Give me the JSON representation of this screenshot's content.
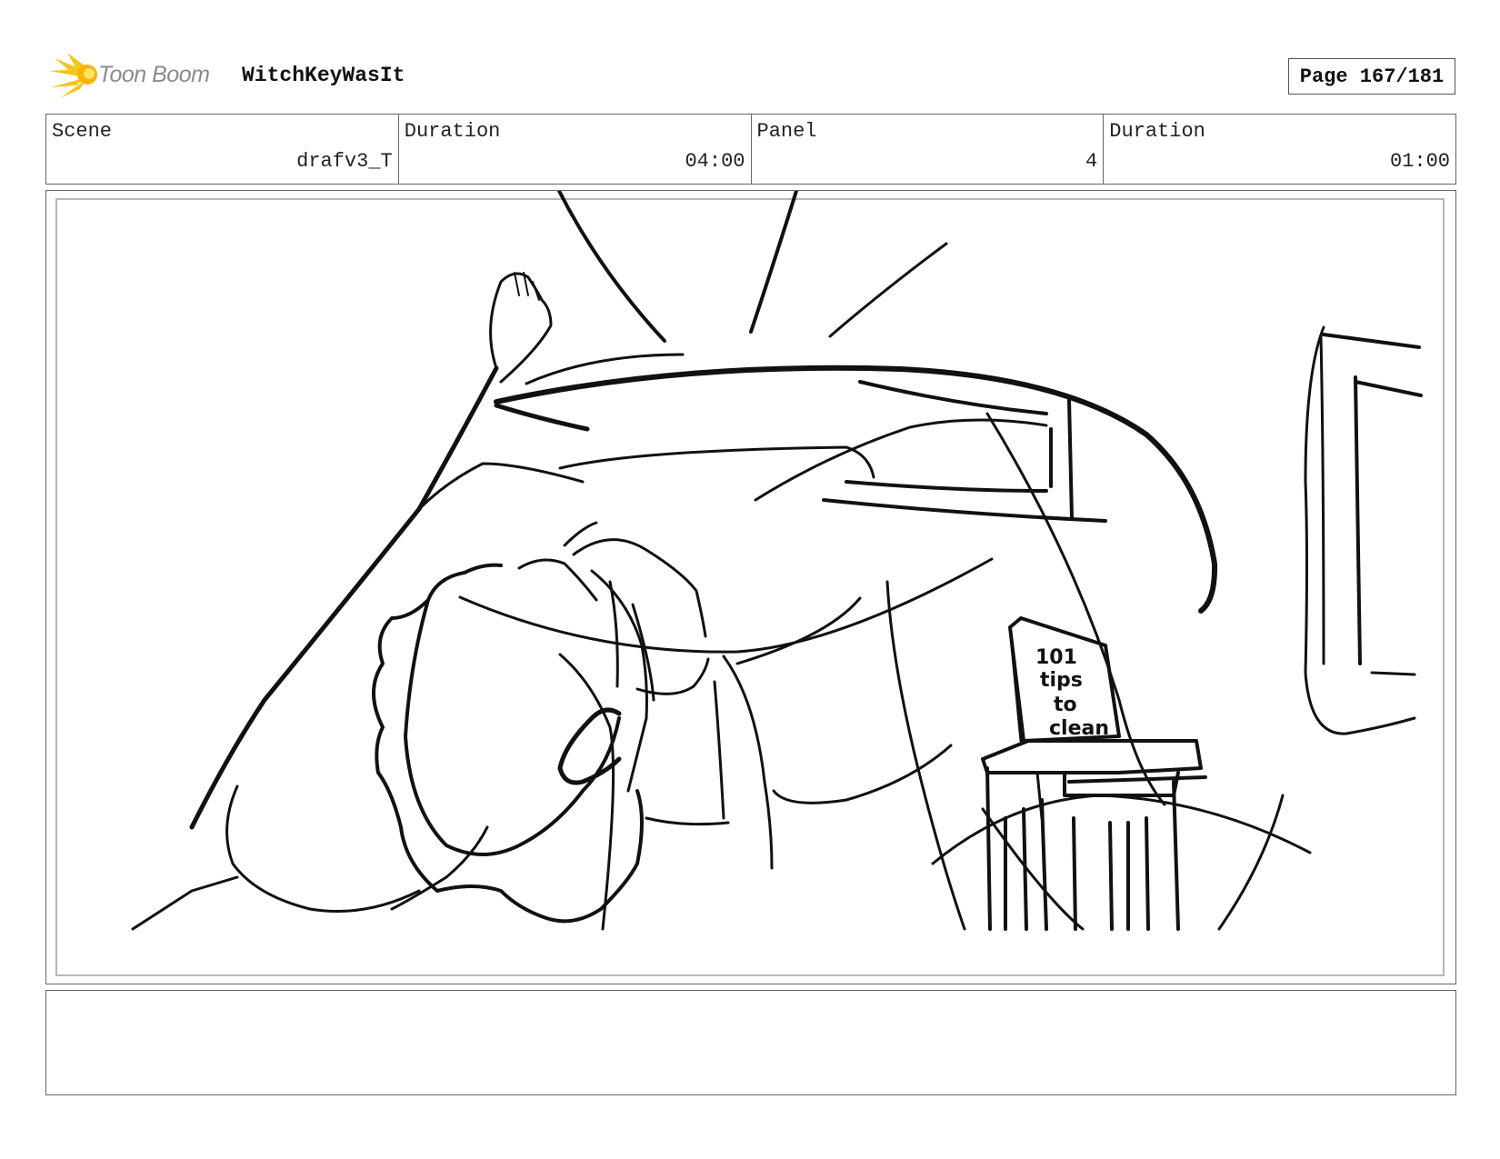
{
  "header": {
    "brand": "Toon Boom",
    "brand_icon": "toon-boom-starburst-icon",
    "project_title": "WitchKeyWasIt",
    "page_label": "Page 167/181"
  },
  "info": {
    "scene_label": "Scene",
    "scene_value": "drafv3_T",
    "scene_duration_label": "Duration",
    "scene_duration_value": "04:00",
    "panel_label": "Panel",
    "panel_value": "4",
    "panel_duration_label": "Duration",
    "panel_duration_value": "01:00"
  },
  "panel": {
    "sketch_text": [
      "101",
      "tips",
      "to",
      "clean"
    ]
  },
  "notes": {
    "text": ""
  },
  "colors": {
    "logo_yellow": "#f5c518",
    "logo_orange": "#f39c12",
    "ink": "#111111"
  }
}
